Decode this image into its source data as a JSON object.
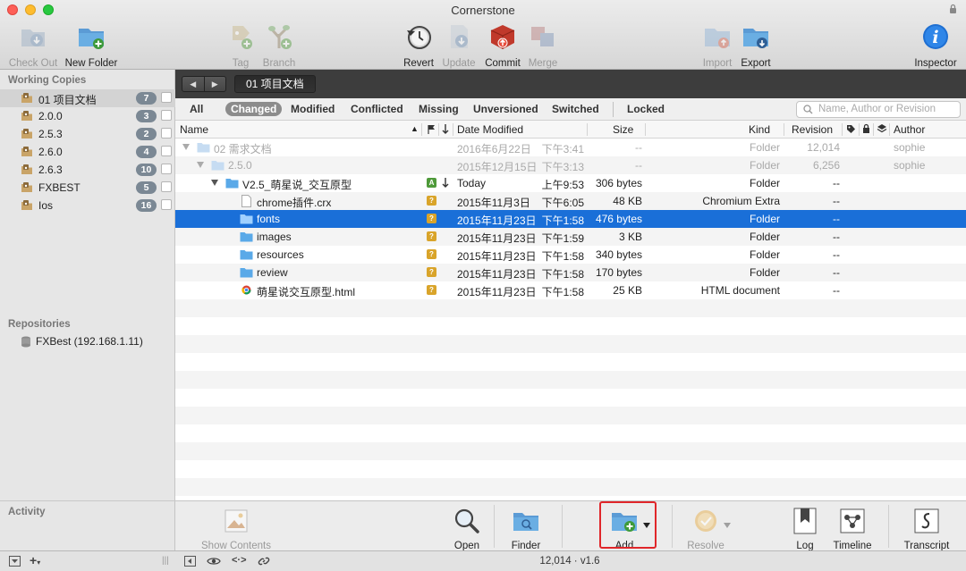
{
  "window": {
    "title": "Cornerstone"
  },
  "toolbar": {
    "checkout": "Check Out",
    "new_folder": "New Folder",
    "tag": "Tag",
    "branch": "Branch",
    "revert": "Revert",
    "update": "Update",
    "commit": "Commit",
    "merge": "Merge",
    "import": "Import",
    "export": "Export",
    "inspector": "Inspector"
  },
  "sidebar": {
    "working_copies_heading": "Working Copies",
    "working_copies": [
      {
        "label": "01 项目文档",
        "count": "7"
      },
      {
        "label": "2.0.0",
        "count": "3"
      },
      {
        "label": "2.5.3",
        "count": "2"
      },
      {
        "label": "2.6.0",
        "count": "4"
      },
      {
        "label": "2.6.3",
        "count": "10"
      },
      {
        "label": "FXBEST",
        "count": "5"
      },
      {
        "label": "Ios",
        "count": "16"
      }
    ],
    "repositories_heading": "Repositories",
    "repository": "FXBest (192.168.1.11)",
    "activity_heading": "Activity"
  },
  "path": {
    "crumb": "01 项目文档"
  },
  "filters": {
    "all": "All",
    "changed": "Changed",
    "modified": "Modified",
    "conflicted": "Conflicted",
    "missing": "Missing",
    "unversioned": "Unversioned",
    "switched": "Switched",
    "locked": "Locked",
    "search_placeholder": "Name, Author or Revision"
  },
  "columns": {
    "name": "Name",
    "date": "Date Modified",
    "size": "Size",
    "kind": "Kind",
    "revision": "Revision",
    "author": "Author"
  },
  "rows": [
    {
      "name": "02 需求文档",
      "date": "2016年6月22日",
      "time": "下午3:41",
      "size": "--",
      "kind": "Folder",
      "rev": "12,014",
      "author": "sophie"
    },
    {
      "name": "2.5.0",
      "date": "2015年12月15日",
      "time": "下午3:13",
      "size": "--",
      "kind": "Folder",
      "rev": "6,256",
      "author": "sophie"
    },
    {
      "name": "V2.5_萌星说_交互原型",
      "date": "Today",
      "time": "上午9:53",
      "size": "306 bytes",
      "kind": "Folder",
      "rev": "--",
      "author": ""
    },
    {
      "name": "chrome插件.crx",
      "date": "2015年11月3日",
      "time": "下午6:05",
      "size": "48 KB",
      "kind": "Chromium Extra",
      "rev": "--",
      "author": ""
    },
    {
      "name": "fonts",
      "date": "2015年11月23日",
      "time": "下午1:58",
      "size": "476 bytes",
      "kind": "Folder",
      "rev": "--",
      "author": ""
    },
    {
      "name": "images",
      "date": "2015年11月23日",
      "time": "下午1:59",
      "size": "3 KB",
      "kind": "Folder",
      "rev": "--",
      "author": ""
    },
    {
      "name": "resources",
      "date": "2015年11月23日",
      "time": "下午1:58",
      "size": "340 bytes",
      "kind": "Folder",
      "rev": "--",
      "author": ""
    },
    {
      "name": "review",
      "date": "2015年11月23日",
      "time": "下午1:58",
      "size": "170 bytes",
      "kind": "Folder",
      "rev": "--",
      "author": ""
    },
    {
      "name": "萌星说交互原型.html",
      "date": "2015年11月23日",
      "time": "下午1:58",
      "size": "25 KB",
      "kind": "HTML document",
      "rev": "--",
      "author": ""
    }
  ],
  "actions": {
    "show_contents": "Show Contents",
    "open": "Open",
    "finder": "Finder",
    "add": "Add",
    "resolve": "Resolve",
    "log": "Log",
    "timeline": "Timeline",
    "transcript": "Transcript"
  },
  "status": {
    "text": "12,014 · v1.6"
  },
  "colors": {
    "selection": "#1a6fd8",
    "highlight": "#e0262a",
    "badge": "#7b8894"
  }
}
